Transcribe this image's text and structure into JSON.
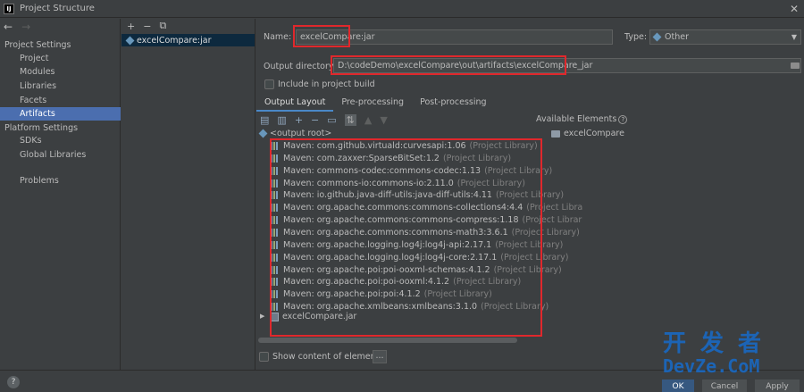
{
  "window": {
    "title": "Project Structure",
    "app_icon": "IJ"
  },
  "nav": {
    "project_settings": "Project Settings",
    "items_project": [
      "Project",
      "Modules",
      "Libraries",
      "Facets",
      "Artifacts"
    ],
    "platform_settings": "Platform Settings",
    "items_platform": [
      "SDKs",
      "Global Libraries"
    ],
    "problems": "Problems",
    "selected": "Artifacts"
  },
  "artifact_list": {
    "items": [
      "excelCompare:jar"
    ]
  },
  "form": {
    "name_label": "Name:",
    "name_value": "excelCompare:jar",
    "type_label": "Type:",
    "type_value": "Other",
    "output_dir_label": "Output directory:",
    "output_dir_value": "D:\\codeDemo\\excelCompare\\out\\artifacts\\excelCompare_jar",
    "include_in_build": "Include in project build"
  },
  "tabs": [
    "Output Layout",
    "Pre-processing",
    "Post-processing"
  ],
  "active_tab": "Output Layout",
  "tree": {
    "root": "<output root>",
    "libraries": [
      {
        "name": "Maven: com.github.virtuald:curvesapi:1.06",
        "suffix": "(Project Library)"
      },
      {
        "name": "Maven: com.zaxxer:SparseBitSet:1.2",
        "suffix": "(Project Library)"
      },
      {
        "name": "Maven: commons-codec:commons-codec:1.13",
        "suffix": "(Project Library)"
      },
      {
        "name": "Maven: commons-io:commons-io:2.11.0",
        "suffix": "(Project Library)"
      },
      {
        "name": "Maven: io.github.java-diff-utils:java-diff-utils:4.11",
        "suffix": "(Project Library)"
      },
      {
        "name": "Maven: org.apache.commons:commons-collections4:4.4",
        "suffix": "(Project Libra"
      },
      {
        "name": "Maven: org.apache.commons:commons-compress:1.18",
        "suffix": "(Project Librar"
      },
      {
        "name": "Maven: org.apache.commons:commons-math3:3.6.1",
        "suffix": "(Project Library)"
      },
      {
        "name": "Maven: org.apache.logging.log4j:log4j-api:2.17.1",
        "suffix": "(Project Library)"
      },
      {
        "name": "Maven: org.apache.logging.log4j:log4j-core:2.17.1",
        "suffix": "(Project Library)"
      },
      {
        "name": "Maven: org.apache.poi:poi-ooxml-schemas:4.1.2",
        "suffix": "(Project Library)"
      },
      {
        "name": "Maven: org.apache.poi:poi-ooxml:4.1.2",
        "suffix": "(Project Library)"
      },
      {
        "name": "Maven: org.apache.poi:poi:4.1.2",
        "suffix": "(Project Library)"
      },
      {
        "name": "Maven: org.apache.xmlbeans:xmlbeans:3.1.0",
        "suffix": "(Project Library)"
      }
    ],
    "jar": "excelCompare.jar"
  },
  "available": {
    "title": "Available Elements",
    "items": [
      "excelCompare"
    ]
  },
  "show_content": "Show content of elements",
  "ellipsis": "...",
  "footer": {
    "help": "?",
    "ok": "OK",
    "cancel": "Cancel",
    "apply": "Apply"
  },
  "watermark": {
    "top": "开发者",
    "bottom": "DevZe.CoM"
  },
  "colors": {
    "highlight": "#e0282c",
    "selection": "#4b6eaf",
    "background": "#3c3f41"
  }
}
